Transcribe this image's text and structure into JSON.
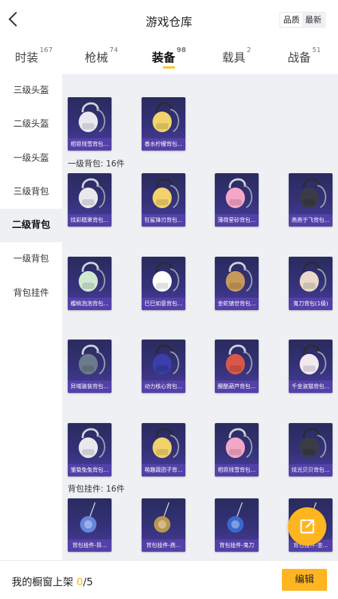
{
  "header": {
    "title": "游戏仓库",
    "sort_options": [
      "品质",
      "最新"
    ],
    "sort_selected": "品质"
  },
  "tabs": [
    {
      "label": "时装",
      "count": "167"
    },
    {
      "label": "枪械",
      "count": "74"
    },
    {
      "label": "装备",
      "count": "98"
    },
    {
      "label": "载具",
      "count": "2"
    },
    {
      "label": "战备",
      "count": "51"
    }
  ],
  "active_tab": "装备",
  "sidebar": [
    {
      "label": "三级头盔"
    },
    {
      "label": "二级头盔"
    },
    {
      "label": "一级头盔"
    },
    {
      "label": "三级背包"
    },
    {
      "label": "二级背包"
    },
    {
      "label": "一级背包"
    },
    {
      "label": "背包挂件"
    }
  ],
  "active_sidebar": "二级背包",
  "sections": [
    {
      "label": "",
      "items": [
        "相思残雪背包...",
        "香水柠檬背包..."
      ]
    },
    {
      "label": "一级背包: 16件",
      "items": [
        "炫彩糕果背包...",
        "狂鲨锋刃背包...",
        "薄荷星砂背包...",
        "燕燕于飞背包...",
        "樱桃泡泡背包...",
        "巳巳如意背包...",
        "金蛇镇世背包...",
        "鬼刀背包(1级)",
        "异域骇装背包...",
        "动力核心背包...",
        "醒酷葫芦背包...",
        "千金淑猫背包...",
        "雏菊兔兔背包...",
        "萌趣蔬团子背...",
        "相思残雪背包...",
        "炫光贝贝背包..."
      ]
    },
    {
      "label": "背包挂件: 16件",
      "items": [
        "背包挂件-目...",
        "背包挂件-燕...",
        "背包挂件-鬼刀",
        "背包挂件-金..."
      ]
    }
  ],
  "footer": {
    "label": "我的橱窗上架",
    "current": "0",
    "total": "/5",
    "edit_label": "编辑"
  },
  "colors": {
    "accent": "#ffb51f",
    "card_caption": "#5441a8",
    "card_bg": "#2f2e6e",
    "panel_bg": "#eef0f4"
  },
  "icons": {
    "back": "chevron-left-icon",
    "share": "share-external-icon"
  }
}
